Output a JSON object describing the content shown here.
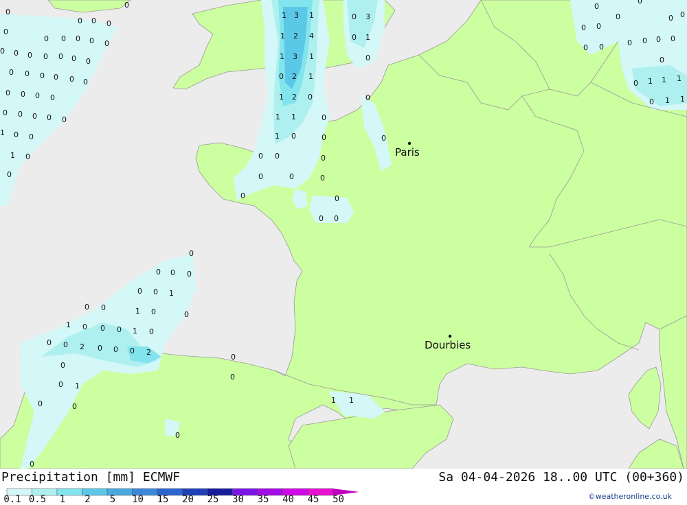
{
  "header": {
    "title": "Precipitation [mm] ECMWF",
    "datetime": "Sa 04-04-2026 18..00 UTC (00+360)"
  },
  "cities": [
    {
      "name": "Paris"
    },
    {
      "name": "Dourbies"
    }
  ],
  "legend": {
    "ticks": [
      "0.1",
      "0.5",
      "1",
      "2",
      "5",
      "10",
      "15",
      "20",
      "25",
      "30",
      "35",
      "40",
      "45",
      "50"
    ],
    "colors": [
      "#d4f7f7",
      "#aef0f0",
      "#82e4ec",
      "#5cc8e8",
      "#48a8e0",
      "#3c88d8",
      "#2c64d0",
      "#2040b8",
      "#181c9c",
      "#7c14e8",
      "#a40ce8",
      "#d008e8",
      "#e810d0",
      "#c000c0"
    ]
  },
  "credit": "©weatheronline.co.uk",
  "colors": {
    "sea": "#ececec",
    "land": "#ccff a0",
    "border": "#9a9a9a"
  }
}
